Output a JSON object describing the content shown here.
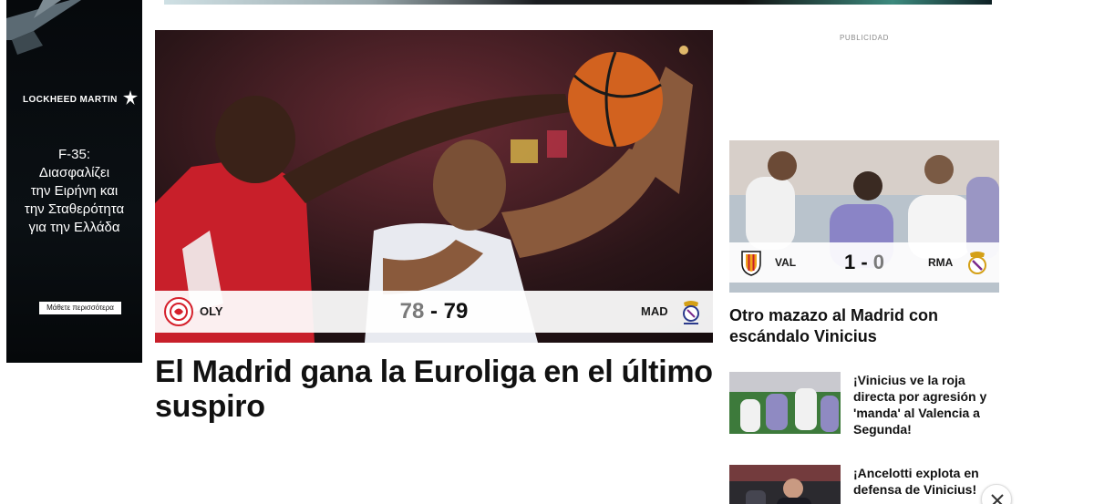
{
  "top_banner": {},
  "side_ad": {
    "brand": "LOCKHEED MARTIN",
    "copy_line1": "F-35:",
    "copy_line2": "Διασφαλίζει",
    "copy_line3": "την Ειρήνη και",
    "copy_line4": "την Σταθερότητα",
    "copy_line5": "για την Ελλάδα",
    "cta": "Μάθετε περισσότερα",
    "icons": [
      "star-logo-icon",
      "jet-silhouette-icon"
    ]
  },
  "hero": {
    "home_abbr": "OLY",
    "away_abbr": "MAD",
    "home_score": "78",
    "separator": "-",
    "away_score": "79",
    "headline": "El Madrid gana la Euroliga en el último suspiro",
    "icons": [
      "olympiacos-crest-icon",
      "real-madrid-baloncesto-crest-icon"
    ]
  },
  "sidebar": {
    "ad_label": "PUBLICIDAD",
    "feature": {
      "home_abbr": "VAL",
      "away_abbr": "RMA",
      "home_score": "1",
      "separator": "-",
      "away_score": "0",
      "headline": "Otro mazazo al Madrid con escándalo Vinicius",
      "icons": [
        "valencia-crest-icon",
        "real-madrid-crest-icon"
      ]
    },
    "news": [
      {
        "title": "¡Vinicius ve la roja directa por agresión y 'manda' al Valencia a Segunda!"
      },
      {
        "title": "¡Ancelotti explota en defensa de Vinicius!"
      }
    ]
  },
  "colors": {
    "olympiacos_red": "#d5202b",
    "page_bg": "#ffffff",
    "text": "#111111",
    "muted": "#7a7a7a"
  },
  "close_button_icon": "close-x-icon"
}
